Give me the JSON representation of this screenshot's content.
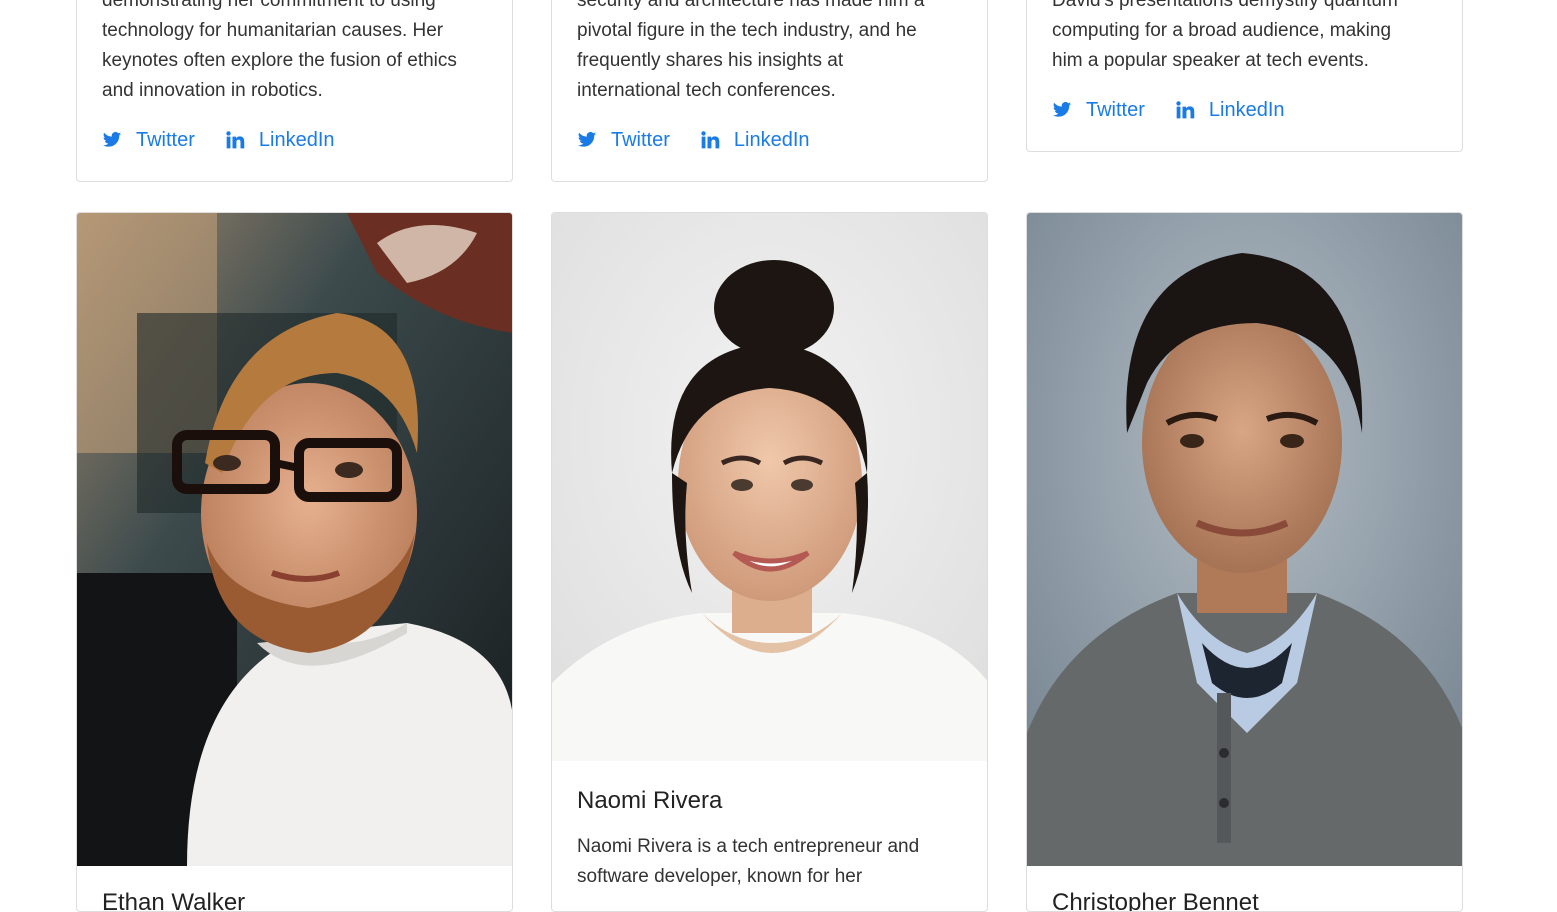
{
  "top_cards": [
    {
      "text": "demonstrating her commitment to using technology for humanitarian causes. Her keynotes often explore the fusion of ethics and innovation in robotics.",
      "lines": [
        "demonstrating her commitment to using",
        "technology for humanitarian causes. Her",
        "keynotes often explore the fusion of ethics",
        "and innovation in robotics."
      ],
      "twitter_label": "Twitter",
      "linkedin_label": "LinkedIn"
    },
    {
      "lines": [
        "security and architecture has made him a",
        "pivotal figure in the tech industry, and he",
        "frequently shares his insights at",
        "international tech conferences."
      ],
      "twitter_label": "Twitter",
      "linkedin_label": "LinkedIn"
    },
    {
      "lines": [
        "David's presentations demystify quantum",
        "computing for a broad audience, making",
        "him a popular speaker at tech events."
      ],
      "twitter_label": "Twitter",
      "linkedin_label": "LinkedIn"
    }
  ],
  "bottom_cards": [
    {
      "name": "Ethan Walker",
      "photo_icon": "portrait-man-glasses-beard"
    },
    {
      "name": "Naomi Rivera",
      "photo_icon": "portrait-woman-bun",
      "lines": [
        "Naomi Rivera is a tech entrepreneur and",
        "software developer, known for her"
      ]
    },
    {
      "name": "Christopher Bennet",
      "photo_icon": "portrait-man-sweater"
    }
  ],
  "colors": {
    "link": "#1a7be6",
    "border": "#dddddd",
    "text": "#333333"
  }
}
